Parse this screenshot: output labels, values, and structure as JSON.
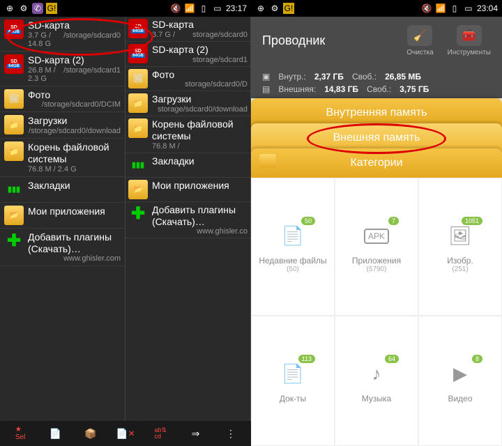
{
  "left": {
    "status": {
      "time": "23:17"
    },
    "items": [
      {
        "ico": "sd",
        "title": "SD-карта",
        "size": "3.7 G / 14.8 G",
        "path": "/storage/sdcard0"
      },
      {
        "ico": "sd",
        "title": "SD-карта (2)",
        "size": "26.8 M / 2.3 G",
        "path": "/storage/sdcard1"
      },
      {
        "ico": "photo",
        "title": "Фото",
        "size": "",
        "path": "/storage/sdcard0/DCIM"
      },
      {
        "ico": "folder",
        "title": "Загрузки",
        "size": "",
        "path": "/storage/sdcard0/download"
      },
      {
        "ico": "folder",
        "title": "Корень файловой системы",
        "size": "76.8 M / 2.4 G",
        "path": ""
      },
      {
        "ico": "bookmark",
        "title": "Закладки",
        "size": "",
        "path": ""
      },
      {
        "ico": "apps",
        "title": "Мои приложения",
        "size": "",
        "path": ""
      },
      {
        "ico": "plus",
        "title": "Добавить плагины (Скачать)…",
        "size": "",
        "path": "www.ghisler.com"
      }
    ],
    "items2": [
      {
        "ico": "sd",
        "title": "SD-карта",
        "size": "3.7 G /",
        "path": "storage/sdcard0"
      },
      {
        "ico": "sd",
        "title": "SD-карта (2)",
        "size": "",
        "path": "storage/sdcard1"
      },
      {
        "ico": "photo",
        "title": "Фото",
        "size": "",
        "path": "storage/sdcard0/D"
      },
      {
        "ico": "folder",
        "title": "Загрузки",
        "size": "",
        "path": "storage/sdcard0/download"
      },
      {
        "ico": "folder",
        "title": "Корень файловой системы",
        "size": "76.8 M /",
        "path": ""
      },
      {
        "ico": "bookmark",
        "title": "Закладки",
        "size": "",
        "path": ""
      },
      {
        "ico": "apps",
        "title": "Мои приложения",
        "size": "",
        "path": ""
      },
      {
        "ico": "plus",
        "title": "Добавить плагины (Скачать)…",
        "size": "",
        "path": "www.ghisler.co"
      }
    ]
  },
  "right": {
    "status": {
      "time": "23:04"
    },
    "header": {
      "title": "Проводник",
      "tool1": "Очистка",
      "tool2": "Инструменты"
    },
    "storage": {
      "row1": {
        "label": "Внутр.:",
        "val": "2,37 ГБ",
        "free_label": "Своб.:",
        "free": "26,85 МБ"
      },
      "row2": {
        "label": "Внешняя:",
        "val": "14,83 ГБ",
        "free_label": "Своб.:",
        "free": "3,75 ГБ"
      }
    },
    "tabs": {
      "t1": "Внутренняя память",
      "t2": "Внешняя память",
      "t3": "Категории"
    },
    "grid": [
      {
        "badge": "50",
        "title": "Недавние файлы",
        "sub": "(50)"
      },
      {
        "badge": "7",
        "title": "Приложения",
        "sub": "(5790)"
      },
      {
        "badge": "1051",
        "title": "Изобр.",
        "sub": "(251)"
      },
      {
        "badge": "113",
        "title": "Док-ты",
        "sub": ""
      },
      {
        "badge": "64",
        "title": "Музыка",
        "sub": ""
      },
      {
        "badge": "8",
        "title": "Видео",
        "sub": ""
      }
    ]
  }
}
